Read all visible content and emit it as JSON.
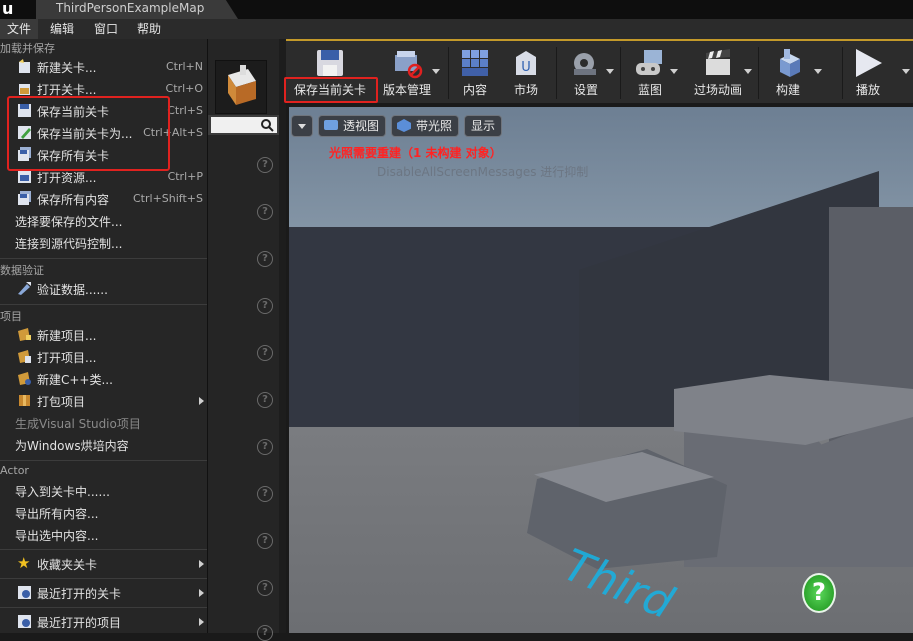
{
  "titlebar": {
    "tab_title": "ThirdPersonExampleMap",
    "logo": "u"
  },
  "menubar": {
    "items": [
      "文件",
      "编辑",
      "窗口",
      "帮助"
    ]
  },
  "filemenu": {
    "sections": {
      "load_save": "加载并保存",
      "data_validation": "数据验证",
      "project": "项目",
      "actor": "Actor"
    },
    "items": [
      {
        "label": "新建关卡...",
        "shortcut": "Ctrl+N",
        "icon": "new-level-icon"
      },
      {
        "label": "打开关卡...",
        "shortcut": "Ctrl+O",
        "icon": "open-level-icon"
      },
      {
        "label": "保存当前关卡",
        "shortcut": "Ctrl+S",
        "icon": "save-icon"
      },
      {
        "label": "保存当前关卡为...",
        "shortcut": "Ctrl+Alt+S",
        "icon": "save-as-icon"
      },
      {
        "label": "保存所有关卡",
        "shortcut": "",
        "icon": "save-all-icon"
      },
      {
        "label": "打开资源...",
        "shortcut": "Ctrl+P",
        "icon": "open-asset-icon"
      },
      {
        "label": "保存所有内容",
        "shortcut": "Ctrl+Shift+S",
        "icon": "save-all-content-icon"
      },
      {
        "label": "选择要保存的文件...",
        "shortcut": ""
      },
      {
        "label": "连接到源代码控制...",
        "shortcut": ""
      },
      {
        "label": "验证数据......",
        "shortcut": "",
        "icon": "validate-icon"
      },
      {
        "label": "新建项目...",
        "shortcut": "",
        "icon": "new-project-icon"
      },
      {
        "label": "打开项目...",
        "shortcut": "",
        "icon": "open-project-icon"
      },
      {
        "label": "新建C++类...",
        "shortcut": "",
        "icon": "new-cpp-class-icon"
      },
      {
        "label": "打包项目",
        "shortcut": "",
        "icon": "package-icon"
      },
      {
        "label": "生成Visual Studio项目",
        "shortcut": ""
      },
      {
        "label": "为Windows烘培内容",
        "shortcut": ""
      },
      {
        "label": "导入到关卡中......",
        "shortcut": ""
      },
      {
        "label": "导出所有内容...",
        "shortcut": ""
      },
      {
        "label": "导出选中内容...",
        "shortcut": ""
      },
      {
        "label": "收藏夹关卡",
        "shortcut": "",
        "icon": "star-icon"
      },
      {
        "label": "最近打开的关卡",
        "shortcut": "",
        "icon": "recent-levels-icon"
      },
      {
        "label": "最近打开的项目",
        "shortcut": "",
        "icon": "recent-projects-icon"
      }
    ]
  },
  "toolbar": {
    "items": [
      {
        "label": "保存当前关卡",
        "icon": "save-icon"
      },
      {
        "label": "版本管理",
        "icon": "source-control-icon"
      },
      {
        "label": "内容",
        "icon": "content-icon"
      },
      {
        "label": "市场",
        "icon": "marketplace-icon"
      },
      {
        "label": "设置",
        "icon": "settings-icon"
      },
      {
        "label": "蓝图",
        "icon": "blueprint-icon"
      },
      {
        "label": "过场动画",
        "icon": "cinematics-icon"
      },
      {
        "label": "构建",
        "icon": "build-icon"
      },
      {
        "label": "播放",
        "icon": "play-icon"
      }
    ]
  },
  "viewport": {
    "buttons": {
      "perspective": "透视图",
      "lit": "带光照",
      "show": "显示"
    },
    "warning": "光照需要重建（1 未构建 对象）",
    "overlay_text": "DisableAllScreenMessages 进行抑制",
    "floor_text": "Third"
  },
  "colors": {
    "highlight": "#e0221f",
    "warning": "#ff2323",
    "accent": "#c49a2a"
  }
}
